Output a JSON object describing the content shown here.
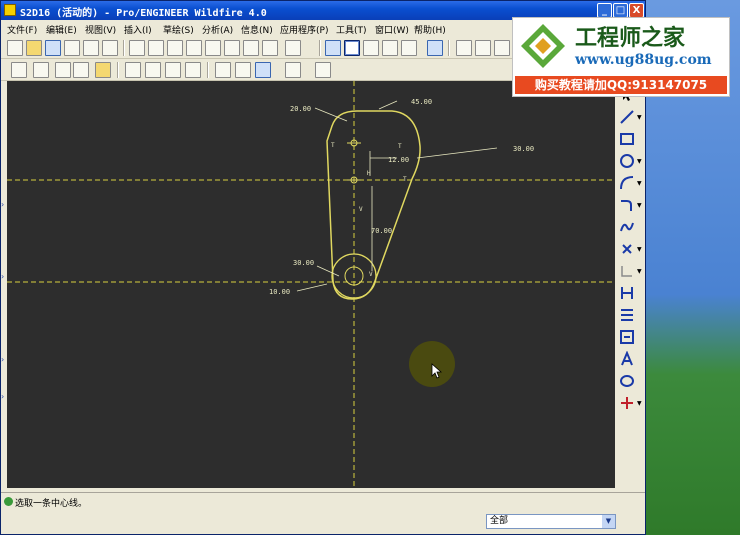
{
  "window": {
    "title": "S2D16 (活动的) - Pro/ENGINEER Wildfire 4.0",
    "controls": {
      "minimize": "_",
      "maximize": "□",
      "close": "X"
    }
  },
  "menubar": {
    "items": [
      "文件(F)",
      "编辑(E)",
      "视图(V)",
      "插入(I)",
      "草绘(S)",
      "分析(A)",
      "信息(N)",
      "应用程序(P)",
      "工具(T)",
      "窗口(W)",
      "帮助(H)"
    ]
  },
  "banner": {
    "name": "工程师之家",
    "url": "www.ug88ug.com",
    "promo": "购买教程请加QQ:913147075"
  },
  "sketch": {
    "dimensions": {
      "d_20_top": "20.00",
      "d_45": "45.00",
      "d_30_right": "30.00",
      "d_12": "12.00",
      "d_70": "70.00",
      "d_30_left": "30.00",
      "d_10": "10.00"
    },
    "constraints": {
      "t1": "T",
      "t2": "T",
      "t3": "T",
      "v": "V",
      "h": "H",
      "v2": "V"
    },
    "colors": {
      "geometry": "#e0d860",
      "centerline": "#d8d040",
      "background": "#2d2d2d"
    }
  },
  "status": {
    "message": "选取一条中心线。"
  },
  "filter": {
    "selected": "全部"
  }
}
